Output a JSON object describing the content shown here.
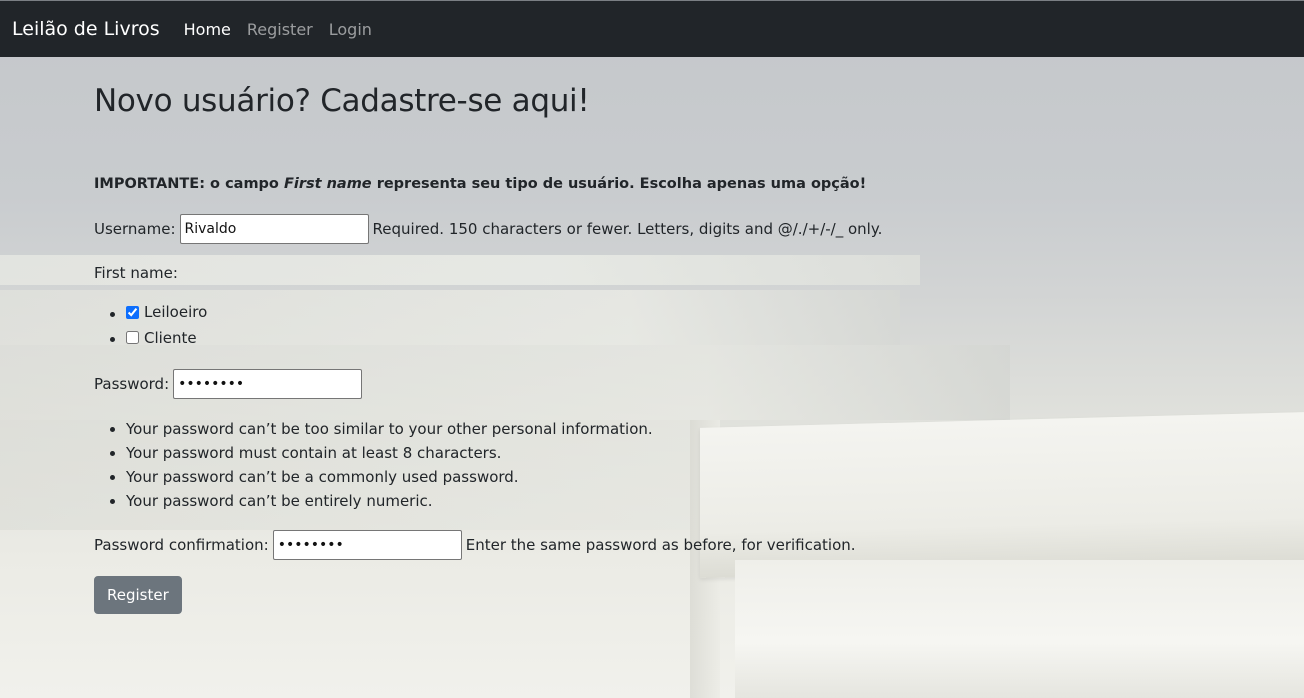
{
  "navbar": {
    "brand": "Leilão de Livros",
    "links": [
      {
        "label": "Home",
        "active": true
      },
      {
        "label": "Register",
        "active": false
      },
      {
        "label": "Login",
        "active": false
      }
    ]
  },
  "page": {
    "title": "Novo usuário? Cadastre-se aqui!",
    "important_prefix": "IMPORTANTE: o campo ",
    "important_field": "First name",
    "important_suffix": " representa seu tipo de usuário. Escolha apenas uma opção!"
  },
  "form": {
    "username": {
      "label": "Username:",
      "value": "Rivaldo",
      "help": "Required. 150 characters or fewer. Letters, digits and @/./+/-/_ only."
    },
    "first_name": {
      "label": "First name:",
      "options": [
        {
          "label": "Leiloeiro",
          "checked": true
        },
        {
          "label": "Cliente",
          "checked": false
        }
      ]
    },
    "password": {
      "label": "Password:",
      "value": "12345678",
      "help": [
        "Your password can’t be too similar to your other personal information.",
        "Your password must contain at least 8 characters.",
        "Your password can’t be a commonly used password.",
        "Your password can’t be entirely numeric."
      ]
    },
    "password_confirmation": {
      "label": "Password confirmation:",
      "value": "12345678",
      "help": "Enter the same password as before, for verification."
    },
    "submit_label": "Register"
  },
  "colors": {
    "navbar_bg": "#212529",
    "button_bg": "#6c757d",
    "checkbox_accent": "#0d6efd"
  }
}
